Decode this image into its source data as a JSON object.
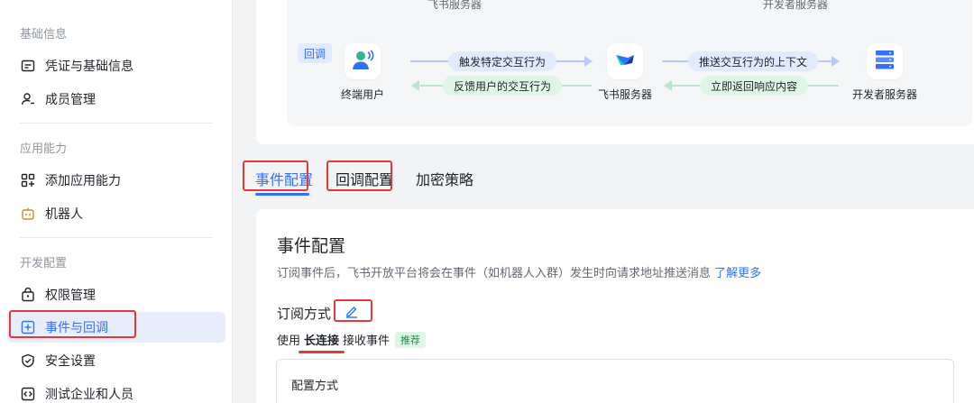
{
  "sidebar": {
    "sections": [
      {
        "title": "基础信息",
        "items": [
          {
            "label": "凭证与基础信息",
            "icon": "credential-icon"
          },
          {
            "label": "成员管理",
            "icon": "member-icon"
          }
        ]
      },
      {
        "title": "应用能力",
        "items": [
          {
            "label": "添加应用能力",
            "icon": "add-capability-icon"
          },
          {
            "label": "机器人",
            "icon": "robot-icon"
          }
        ]
      },
      {
        "title": "开发配置",
        "items": [
          {
            "label": "权限管理",
            "icon": "permission-icon"
          },
          {
            "label": "事件与回调",
            "icon": "event-callback-icon",
            "active": true
          },
          {
            "label": "安全设置",
            "icon": "security-icon"
          },
          {
            "label": "测试企业和人员",
            "icon": "test-icon"
          }
        ]
      }
    ]
  },
  "flow": {
    "top_labels": [
      "飞书服务器",
      "开发者服务器"
    ],
    "badge": "回调",
    "nodes": [
      {
        "label": "终端用户",
        "icon": "user-icon"
      },
      {
        "label": "飞书服务器",
        "icon": "feishu-logo-icon"
      },
      {
        "label": "开发者服务器",
        "icon": "server-icon"
      }
    ],
    "arrows": {
      "a1": "触发特定交互行为",
      "a2": "反馈用户的交互行为",
      "a3": "推送交互行为的上下文",
      "a4": "立即返回响应内容"
    }
  },
  "tabs": [
    {
      "label": "事件配置",
      "active": true
    },
    {
      "label": "回调配置"
    },
    {
      "label": "加密策略"
    }
  ],
  "event_config": {
    "title": "事件配置",
    "description": "订阅事件后，飞书开放平台将会在事件（如机器人入群）发生时向请求地址推送消息",
    "learn_more": "了解更多",
    "subscription_title": "订阅方式",
    "usage_prefix": "使用",
    "usage_strong": "长连接",
    "usage_suffix": "接收事件",
    "recommended_tag": "推荐",
    "config_method_title": "配置方式"
  },
  "colors": {
    "accent": "#3370ff",
    "highlight_red": "#e53935",
    "recommended_green": "#1f8f4c"
  }
}
